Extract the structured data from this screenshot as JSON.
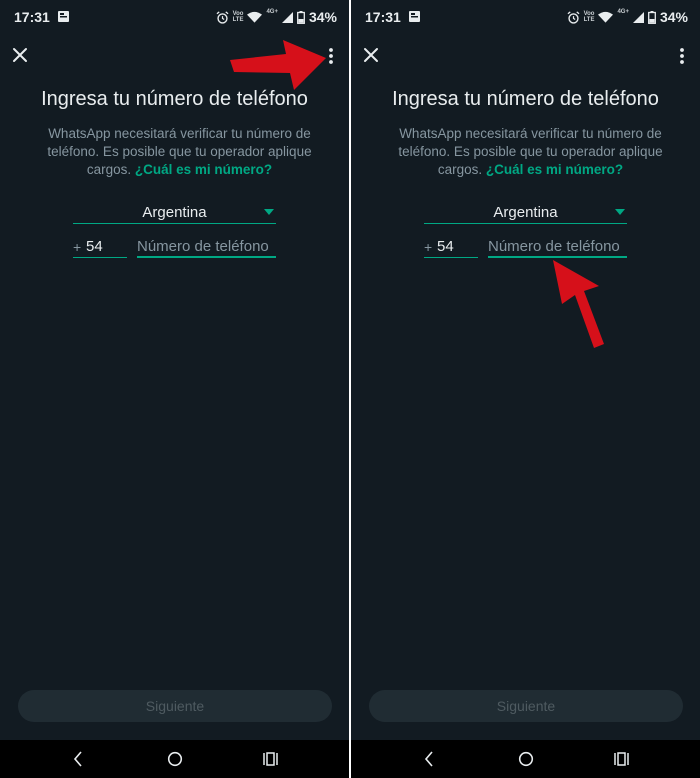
{
  "colors": {
    "background": "#121b22",
    "accent": "#00a884",
    "text_primary": "#e9edef",
    "text_secondary": "#8696a0",
    "button_disabled_bg": "#202c33",
    "arrow_annotation": "#d6101a"
  },
  "screens": [
    {
      "status": {
        "time": "17:31",
        "net_top": "Voo",
        "net_bottom": "LTE",
        "net_gen": "4G+",
        "battery": "34%"
      },
      "icons": {
        "close": "close-icon",
        "menu": "overflow-menu-icon"
      },
      "title": "Ingresa tu número de teléfono",
      "description": "WhatsApp necesitará verificar tu número de teléfono. Es posible que tu operador aplique cargos.",
      "link": "¿Cuál es mi número?",
      "country": "Argentina",
      "plus": "+",
      "country_code": "54",
      "phone_placeholder": "Número de teléfono",
      "next_button": "Siguiente"
    },
    {
      "status": {
        "time": "17:31",
        "net_top": "Voo",
        "net_bottom": "LTE",
        "net_gen": "4G+",
        "battery": "34%"
      },
      "icons": {
        "close": "close-icon",
        "menu": "overflow-menu-icon"
      },
      "title": "Ingresa tu número de teléfono",
      "description": "WhatsApp necesitará verificar tu número de teléfono. Es posible que tu operador aplique cargos.",
      "link": "¿Cuál es mi número?",
      "country": "Argentina",
      "plus": "+",
      "country_code": "54",
      "phone_placeholder": "Número de teléfono",
      "next_button": "Siguiente"
    }
  ]
}
